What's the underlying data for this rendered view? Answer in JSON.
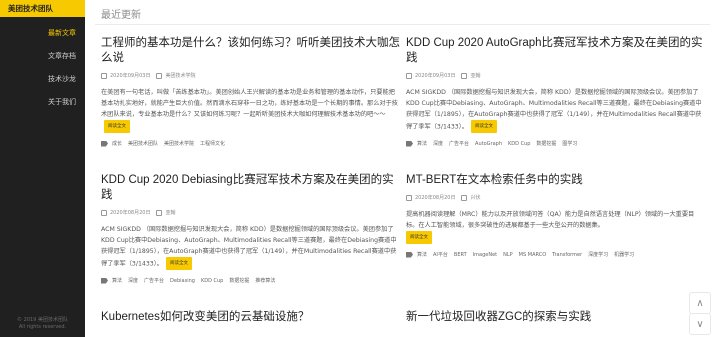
{
  "sidebar": {
    "brand": "美团技术团队",
    "items": [
      {
        "label": "最新文章",
        "active": true
      },
      {
        "label": "文章存档",
        "active": false
      },
      {
        "label": "技术沙龙",
        "active": false
      },
      {
        "label": "关于我们",
        "active": false
      }
    ],
    "copyright_line1": "© 2019 美团技术团队",
    "copyright_line2": "All rights reserved."
  },
  "main": {
    "section_title": "最近更新",
    "read_more_label": "阅读全文",
    "articles": [
      {
        "title": "工程师的基本功是什么？该如何练习？听听美团技术大咖怎么说",
        "date": "2020年09月03日",
        "author": "美团技术学院",
        "summary": "在美团有一句老话，叫做「苦练基本功」。美团创始人王兴解读的基本功是业务和管理的基本动作，只要能把基本功扎实地好，就能产生巨大价值。然而滴水石穿非一日之功，练好基本功是一个长期的事情。那么对于技术团队来说，专业基本功是什么？又该如何练习呢？一起听听美团技术大咖如何理解技术基本功的吧～～",
        "tags": [
          "成长",
          "美团技术团队",
          "美团技术学院",
          "工程师文化"
        ]
      },
      {
        "title": "KDD Cup 2020 AutoGraph比赛冠军技术方案及在美团的实践",
        "date": "2020年09月03日",
        "author": "亚翰",
        "summary": "ACM SIGKDD （国际数据挖掘与知识发现大会，简称 KDD）是数据挖掘领域的国际顶级会议。美团参加了KDD Cup比赛中Debiasing、AutoGraph、Multimodalities Recall等三道赛题，最终在Debiasing赛道中获得冠军（1/1895），在AutoGraph赛道中也获得了冠军（1/149），并在Multimodalities Recall赛道中获得了季军（3/1433）。",
        "tags": [
          "算法",
          "深度",
          "广告平台",
          "AutoGraph",
          "KDD Cup",
          "数据挖掘",
          "图学习"
        ]
      },
      {
        "title": "KDD Cup 2020 Debiasing比赛冠军技术方案及在美团的实践",
        "date": "2020年08月20日",
        "author": "亚翰",
        "summary": "ACM SIGKDD （国际数据挖掘与知识发现大会，简称 KDD）是数据挖掘领域的国际顶级会议。美团参加了KDD Cup比赛中Debiasing、AutoGraph、Multimodalities Recall等三道赛题，最终在Debiasing赛道中获得冠军（1/1895），在AutoGraph赛道中也获得了冠军（1/149），并在Multimodalities Recall赛道中获得了季军（3/1433）。",
        "tags": [
          "算法",
          "深度",
          "广告平台",
          "Debiasing",
          "KDD Cup",
          "数据挖掘",
          "推荐算法"
        ]
      },
      {
        "title": "MT-BERT在文本检索任务中的实践",
        "date": "2020年08月20日",
        "author": "兴伏",
        "summary": "提高机器阅读理解（MRC）能力以及开放领域问答（QA）能力是自然语言处理（NLP）领域的一大重要目标。在人工智能领域，很多突破性的进展都基于一些大型公开的数据集。",
        "tags": [
          "算法",
          "AI平台",
          "BERT",
          "ImageNet",
          "NLP",
          "MS MARCO",
          "Transformer",
          "深度学习",
          "机器学习"
        ]
      },
      {
        "title": "Kubernetes如何改变美团的云基础设施？",
        "date": "",
        "author": "",
        "summary": "",
        "tags": []
      },
      {
        "title": "新一代垃圾回收器ZGC的探索与实践",
        "date": "",
        "author": "",
        "summary": "",
        "tags": []
      }
    ]
  },
  "float_buttons": {
    "up": "∧",
    "down": "∨"
  }
}
